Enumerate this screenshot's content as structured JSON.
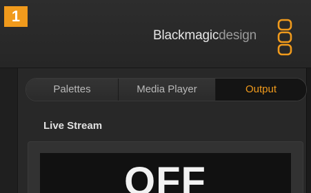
{
  "step": {
    "number": "1"
  },
  "brand": {
    "part_bold": "Blackmagic",
    "part_light": "design",
    "logo_icon": "blackmagic-logo-icon",
    "accent": "#f09a1c"
  },
  "tabs": [
    {
      "label": "Palettes",
      "active": false
    },
    {
      "label": "Media Player",
      "active": false
    },
    {
      "label": "Output",
      "active": true
    }
  ],
  "section": {
    "title": "Live Stream",
    "status": "OFF"
  }
}
